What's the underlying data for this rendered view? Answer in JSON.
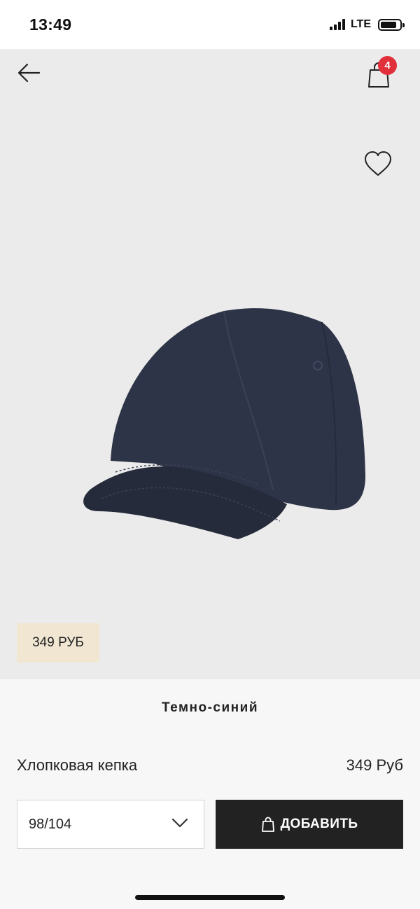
{
  "status_bar": {
    "time": "13:49",
    "network": "LTE"
  },
  "header": {
    "back_icon": "arrow-left-icon",
    "cart_icon": "shopping-bag-icon",
    "cart_count": "4"
  },
  "product": {
    "favorite_icon": "heart-icon",
    "price_tag": "349 РУБ",
    "color_name": "Темно-синий",
    "name": "Хлопковая кепка",
    "price": "349 Руб",
    "cap_color": "#2e3447"
  },
  "actions": {
    "size_value": "98/104",
    "size_chevron_icon": "chevron-down-icon",
    "add_label": "ДОБАВИТЬ",
    "add_icon": "shopping-bag-icon"
  },
  "colors": {
    "badge": "#e1303a",
    "price_tag_bg": "#f0e6d2",
    "button_bg": "#222222"
  }
}
